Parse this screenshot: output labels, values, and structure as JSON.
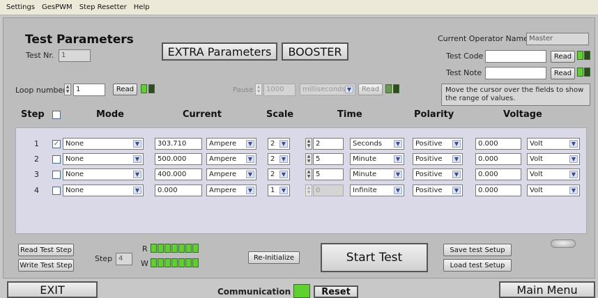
{
  "menu": [
    "Settings",
    "GesPWM",
    "Step Resetter",
    "Help"
  ],
  "test_parameters": {
    "title": "Test Parameters",
    "test_nr_label": "Test Nr.",
    "test_nr_value": "1"
  },
  "buttons": {
    "extra_parameters": "EXTRA Parameters",
    "booster": "BOOSTER",
    "read": "Read",
    "read_test_step": "Read Test Step",
    "write_test_step": "Write Test Step",
    "re_initialize": "Re-Initialize",
    "start_test": "Start Test",
    "save_test_setup": "Save test Setup",
    "load_test_setup": "Load test Setup",
    "exit": "EXIT",
    "reset": "Reset",
    "main_menu": "Main Menu"
  },
  "operator": {
    "label": "Current Operator Name",
    "value": "Master",
    "test_code_label": "Test Code",
    "test_code_value": "",
    "test_note_label": "Test Note",
    "test_note_value": "",
    "hint": "Move the cursor over the fields to show the range of values."
  },
  "loop": {
    "label": "Loop number",
    "value": "1",
    "pause_label": "Pause",
    "pause_value": "1000",
    "pause_unit": "milliseconds"
  },
  "table": {
    "headers": {
      "step": "Step",
      "mode": "Mode",
      "current": "Current",
      "scale": "Scale",
      "time": "Time",
      "polarity": "Polarity",
      "voltage": "Voltage"
    },
    "rows": [
      {
        "step": "1",
        "checked": "✓",
        "mode": "None",
        "current": "303.710",
        "current_unit": "Ampere",
        "scale": "2",
        "time": "2",
        "time_unit": "Seconds",
        "polarity": "Positive",
        "voltage": "0.000",
        "voltage_unit": "Volt"
      },
      {
        "step": "2",
        "checked": "",
        "mode": "None",
        "current": "500.000",
        "current_unit": "Ampere",
        "scale": "2",
        "time": "5",
        "time_unit": "Minute",
        "polarity": "Positive",
        "voltage": "0.000",
        "voltage_unit": "Volt"
      },
      {
        "step": "3",
        "checked": "",
        "mode": "None",
        "current": "400.000",
        "current_unit": "Ampere",
        "scale": "2",
        "time": "5",
        "time_unit": "Minute",
        "polarity": "Positive",
        "voltage": "0.000",
        "voltage_unit": "Volt"
      },
      {
        "step": "4",
        "checked": "",
        "mode": "None",
        "current": "0.000",
        "current_unit": "Ampere",
        "scale": "1",
        "time": "0",
        "time_unit": "Infinite",
        "polarity": "Positive",
        "voltage": "0.000",
        "voltage_unit": "Volt"
      }
    ]
  },
  "bottom": {
    "step_label": "Step",
    "step_value": "4",
    "r_label": "R",
    "w_label": "W",
    "communication_label": "Communication"
  },
  "colors": {
    "led_on": "#5fd030",
    "led_dark": "#2d4c22",
    "panel": "#bdbdbd",
    "table_bg": "#d9d9e8"
  }
}
